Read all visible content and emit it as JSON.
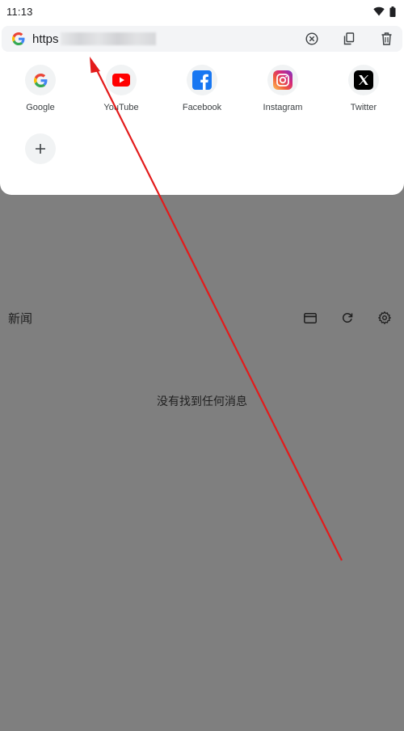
{
  "status_bar": {
    "time": "11:13"
  },
  "url_bar": {
    "value": "https"
  },
  "shortcuts": [
    {
      "label": "Google"
    },
    {
      "label": "YouTube"
    },
    {
      "label": "Facebook"
    },
    {
      "label": "Instagram"
    },
    {
      "label": "Twitter"
    }
  ],
  "news": {
    "title": "新闻",
    "empty_message": "没有找到任何消息"
  },
  "colors": {
    "background_dim": "#7f7f7f",
    "sheet": "#ffffff",
    "annotation_arrow": "#e31b1b",
    "youtube_red": "#ff0000",
    "facebook_blue": "#1877f2"
  }
}
